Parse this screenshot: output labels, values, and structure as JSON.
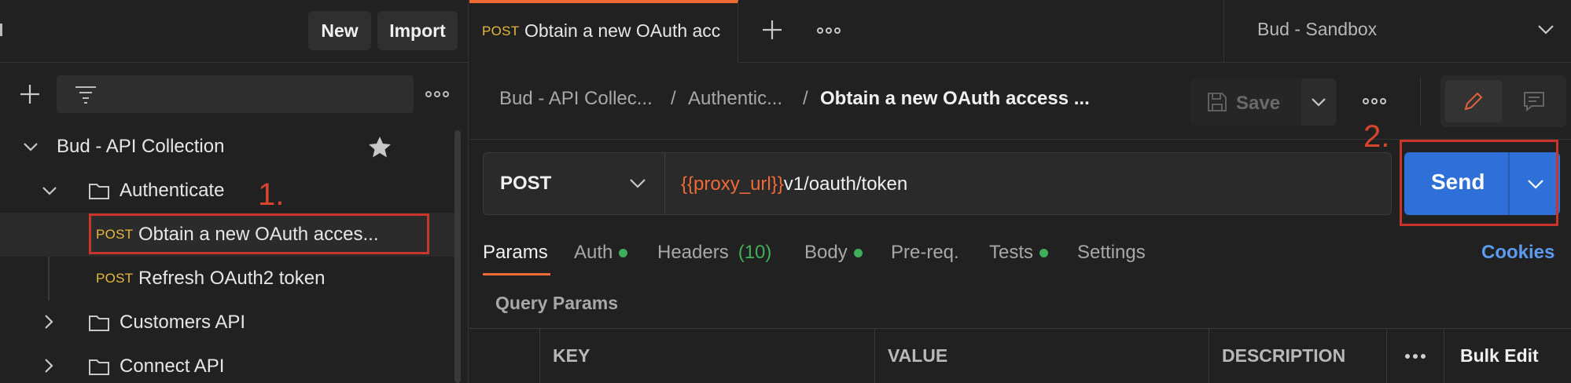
{
  "sidebar": {
    "new_label": "New",
    "import_label": "Import",
    "collection": {
      "name": "Bud - API Collection"
    },
    "folders": [
      {
        "name": "Authenticate"
      },
      {
        "name": "Customers API"
      },
      {
        "name": "Connect API"
      }
    ],
    "requests": [
      {
        "method": "POST",
        "name": "Obtain a new OAuth acces..."
      },
      {
        "method": "POST",
        "name": "Refresh OAuth2 token"
      }
    ]
  },
  "annotations": {
    "one": "1.",
    "two": "2."
  },
  "tab": {
    "method": "POST",
    "title": "Obtain a new OAuth acc"
  },
  "environment": {
    "name": "Bud - Sandbox"
  },
  "breadcrumb": {
    "collection": "Bud - API Collec...",
    "sep1": "/",
    "folder": "Authentic...",
    "sep2": "/",
    "request": "Obtain a new OAuth access ..."
  },
  "toolbar": {
    "save_label": "Save"
  },
  "request": {
    "method": "POST",
    "url_var": "{{proxy_url}}",
    "url_path": "v1/oauth/token",
    "send_label": "Send"
  },
  "request_tabs": {
    "params": "Params",
    "auth": "Auth",
    "headers": "Headers",
    "headers_count": "(10)",
    "body": "Body",
    "prereq": "Pre-req.",
    "tests": "Tests",
    "settings": "Settings",
    "cookies": "Cookies"
  },
  "query_params": {
    "title": "Query Params",
    "columns": {
      "key": "KEY",
      "value": "VALUE",
      "description": "DESCRIPTION",
      "bulk_edit": "Bulk Edit"
    }
  },
  "colors": {
    "accent": "#ef6b36",
    "send": "#2f6fd8",
    "post": "#e8b83a",
    "annotation": "#c8352a",
    "link": "#5b9bf0"
  }
}
